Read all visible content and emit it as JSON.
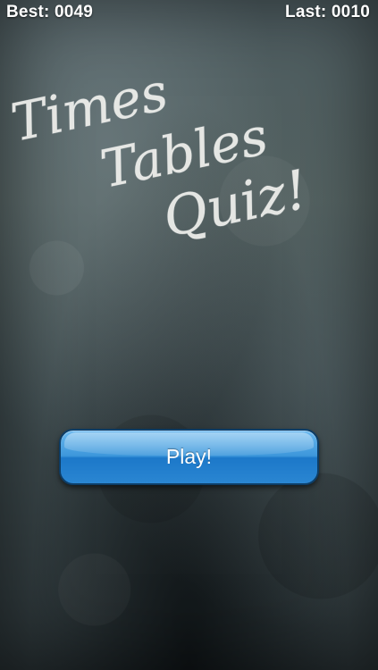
{
  "scores": {
    "best": "Best: 0049",
    "last": "Last: 0010"
  },
  "title": {
    "line1": "Times",
    "line2": "Tables",
    "line3": "Quiz!"
  },
  "play_button": {
    "label": "Play!"
  },
  "colors": {
    "chalkboard": "#4f5e62",
    "chalk": "#f1f1ee",
    "button_blue": "#3d97db",
    "text": "#ffffff"
  }
}
